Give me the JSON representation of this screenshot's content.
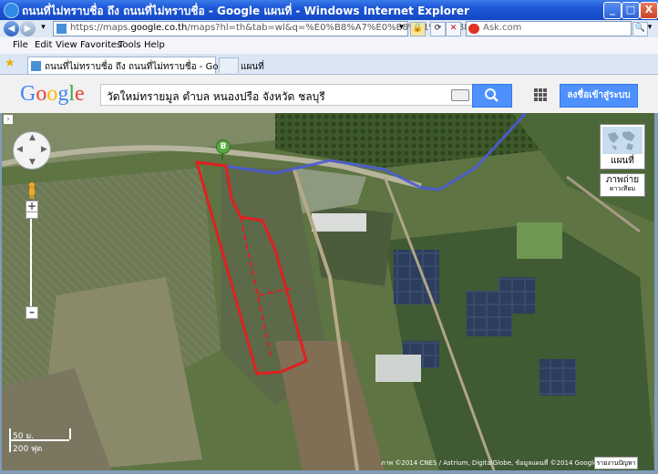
{
  "window": {
    "title": "ถนนที่ไม่ทราบชื่อ ถึง ถนนที่ไม่ทราบชื่อ - Google แผนที่ - Windows Internet Explorer",
    "minimize": "_",
    "maximize": "□",
    "close": "X"
  },
  "address_bar": {
    "url_prefix": "https://maps.",
    "url_host": "google.co.th",
    "url_path": "/maps?hl=th&tab=wl&q=%E0%B8%A7%E0%B8%B1%E0%B8%94",
    "search_placeholder": "Ask.com"
  },
  "menu": {
    "items": [
      "File",
      "Edit",
      "View",
      "Favorites",
      "Tools",
      "Help"
    ]
  },
  "tab": {
    "title": "ถนนที่ไม่ทราบชื่อ ถึง ถนนที่ไม่ทราบชื่อ - Google แผนที่"
  },
  "google": {
    "logo": "Google",
    "query": "วัดใหม่ทรายมูล ตำบล หนองปรือ จังหวัด ชลบุรี",
    "signin": "ลงชื่อเข้าสู่ระบบ"
  },
  "map": {
    "marker_label": "B",
    "map_type_label": "แผนที่",
    "satellite_label": "ภาพถ่าย",
    "satellite_sub": "ดาวเทียม",
    "scale_metric": "50 ม.",
    "scale_imperial": "200 ฟุต",
    "copyright": "ภาพ ©2014 CNES / Astrium, DigitalGlobe, ข้อมูลแผนที่ ©2014 Google",
    "report": "รายงานปัญหา",
    "colors": {
      "route": "#4b5bd8",
      "parcel_outline": "#e02020"
    }
  }
}
